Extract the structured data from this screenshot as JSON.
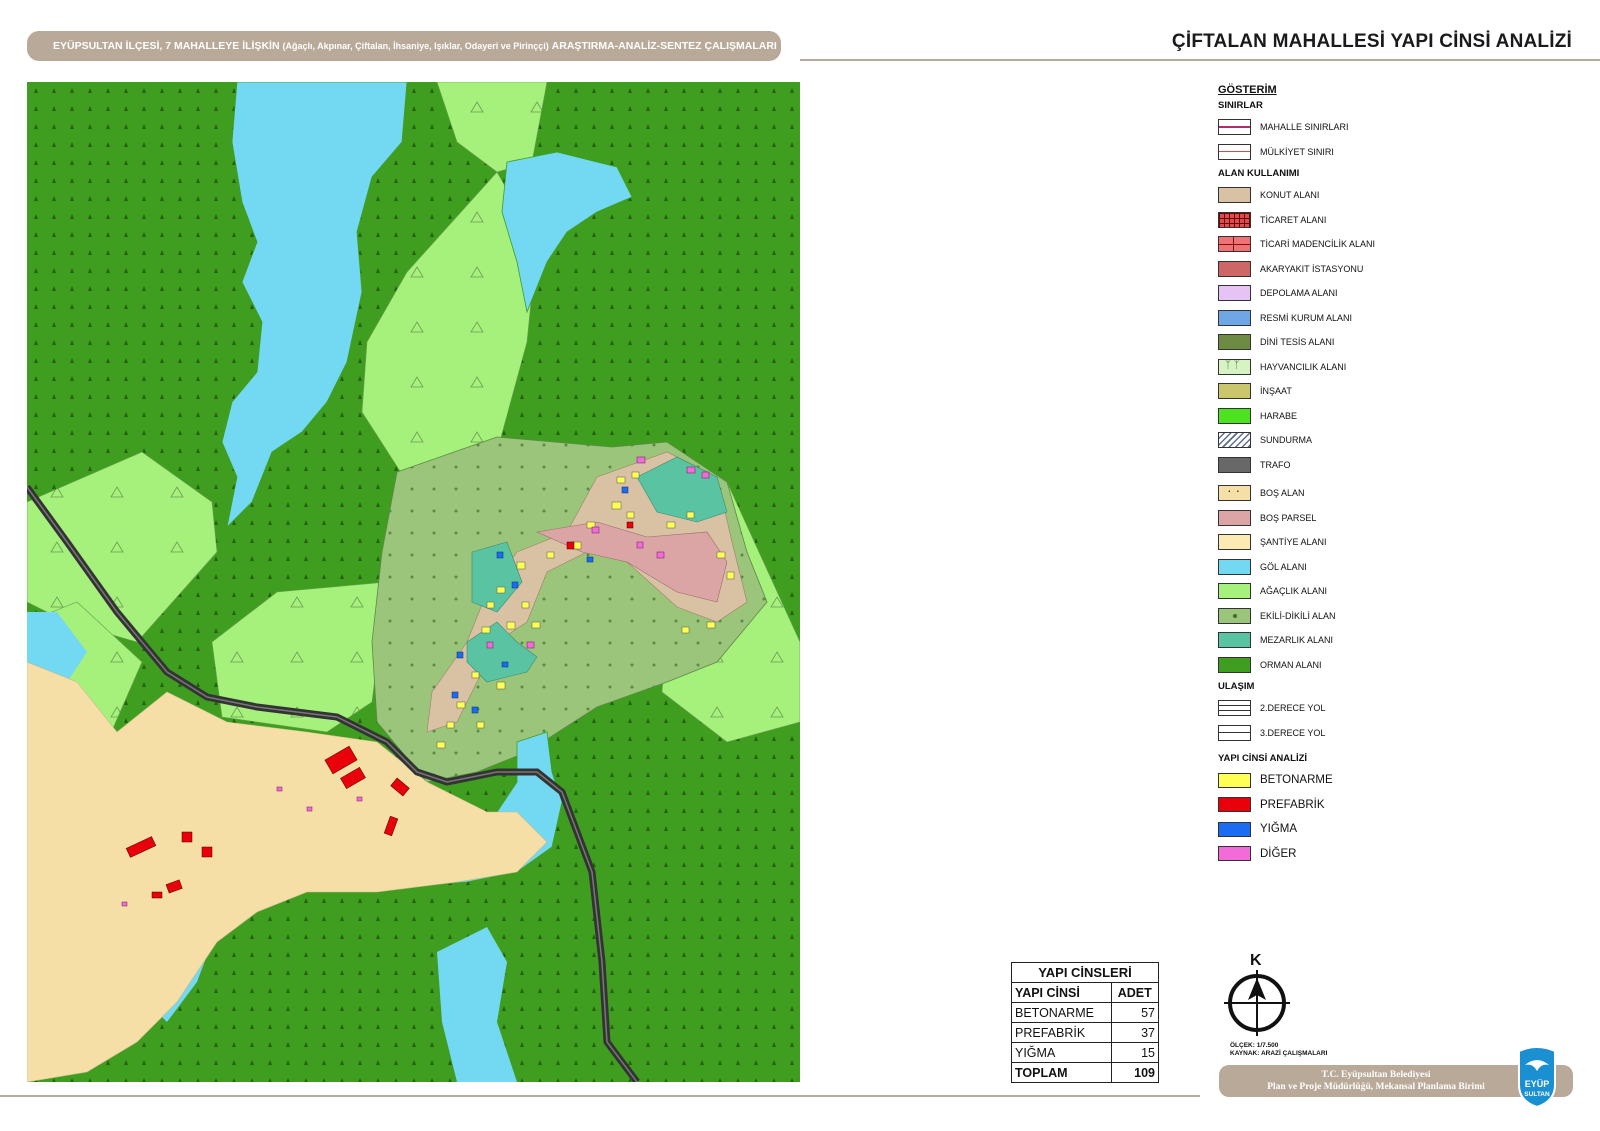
{
  "header": {
    "project_title_main": "EYÜPSULTAN İLÇESİ, 7 MAHALLEYE İLİŞKİN",
    "project_title_neighborhoods": "(Ağaçlı, Akpınar, Çiftalan, İhsaniye, Işıklar, Odayeri ve Pirinççi)",
    "project_title_end": "ARAŞTIRMA-ANALİZ-SENTEZ ÇALIŞMALARI",
    "page_title": "ÇİFTALAN MAHALLESİ YAPI CİNSİ ANALİZİ"
  },
  "legend": {
    "title": "GÖSTERİM",
    "sections": {
      "boundaries": "SINIRLAR",
      "land_use": "ALAN KULLANIMI",
      "transport": "ULAŞIM",
      "building_type": "YAPI CİNSİ ANALİZİ"
    },
    "boundaries": [
      {
        "label": "MAHALLE SINIRLARI"
      },
      {
        "label": "MÜLKİYET SINIRI"
      }
    ],
    "land_use": [
      {
        "label": "KONUT ALANI",
        "color": "#d9c2a3"
      },
      {
        "label": "TİCARET ALANI",
        "color": "#e8474a"
      },
      {
        "label": "TİCARİ MADENCİLİK ALANI",
        "color": "#f07274"
      },
      {
        "label": "AKARYAKIT İSTASYONU",
        "color": "#cd6666"
      },
      {
        "label": "DEPOLAMA ALANI",
        "color": "#e6c3f5"
      },
      {
        "label": "RESMİ KURUM ALANI",
        "color": "#6fa7e6"
      },
      {
        "label": "DİNİ TESİS ALANI",
        "color": "#6d8b43"
      },
      {
        "label": "HAYVANCILIK ALANI",
        "color": "#d8f3c3"
      },
      {
        "label": "İNŞAAT",
        "color": "#c9c66b"
      },
      {
        "label": "HARABE",
        "color": "#4de320"
      },
      {
        "label": "SUNDURMA",
        "color": "#ffffff"
      },
      {
        "label": "TRAFO",
        "color": "#686868"
      }
    ],
    "open_areas": [
      {
        "label": "BOŞ ALAN",
        "color": "#f6dfa6"
      },
      {
        "label": "BOŞ PARSEL",
        "color": "#dba5a5"
      },
      {
        "label": "ŞANTİYE ALANI",
        "color": "#fde9b4"
      },
      {
        "label": "GÖL ALANI",
        "color": "#73d8f2"
      },
      {
        "label": "AĞAÇLIK ALANI",
        "color": "#a6f07c"
      },
      {
        "label": "EKİLİ-DİKİLİ ALAN",
        "color": "#9bc57a"
      },
      {
        "label": "MEZARLIK ALANI",
        "color": "#5ac4a2"
      },
      {
        "label": "ORMAN ALANI",
        "color": "#3f9e1f"
      }
    ],
    "transport": [
      {
        "label": "2.DERECE YOL"
      },
      {
        "label": "3.DERECE YOL"
      }
    ],
    "building_types": [
      {
        "label": "BETONARME",
        "color": "#ffff54"
      },
      {
        "label": "PREFABRİK",
        "color": "#e8000b"
      },
      {
        "label": "YIĞMA",
        "color": "#1a6cf2"
      },
      {
        "label": "DİĞER",
        "color": "#f26bd9"
      }
    ]
  },
  "stats_table": {
    "caption": "YAPI CİNSLERİ",
    "col_type": "YAPI CİNSİ",
    "col_count": "ADET",
    "rows": [
      {
        "type": "BETONARME",
        "count": "57"
      },
      {
        "type": "PREFABRİK",
        "count": "37"
      },
      {
        "type": "YIĞMA",
        "count": "15"
      }
    ],
    "total_label": "TOPLAM",
    "total_count": "109"
  },
  "map_meta": {
    "north_label": "K",
    "scale": "ÖLÇEK: 1/7.500",
    "source": "KAYNAK: ARAZİ ÇALIŞMALARI"
  },
  "footer": {
    "org_line1": "T.C. Eyüpsultan Belediyesi",
    "org_line2": "Plan ve Proje Müdürlüğü, Mekansal Planlama Birimi",
    "logo_text_1": "EYÜP",
    "logo_text_2": "SULTAN"
  }
}
